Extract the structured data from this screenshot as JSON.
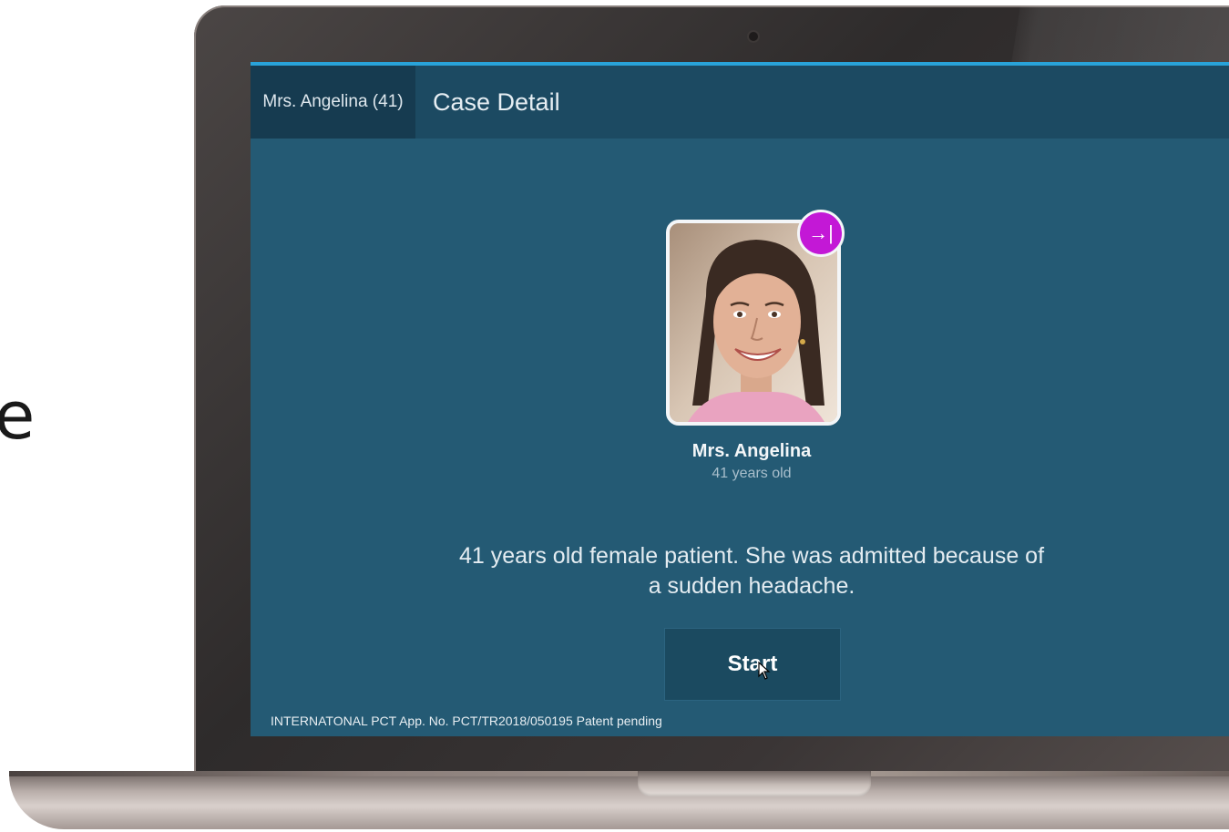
{
  "side_text": "e",
  "app": {
    "tab_patient": "Mrs. Angelina (41)",
    "page_title": "Case Detail"
  },
  "patient": {
    "name": "Mrs. Angelina",
    "age": "41 years old",
    "badge_icon": "arrow-to-end-icon",
    "badge_glyph": "→|",
    "badge_color": "#c318d6",
    "description": "41 years old female patient. She was admitted because of a sudden headache."
  },
  "actions": {
    "start_label": "Start"
  },
  "footer": {
    "patent_text": "INTERNATONAL PCT App. No. PCT/TR2018/050195 Patent pending"
  },
  "colors": {
    "screen_bg": "#245a74",
    "topbar_bg": "#1c4a62",
    "accent_line": "#29a3d9"
  }
}
